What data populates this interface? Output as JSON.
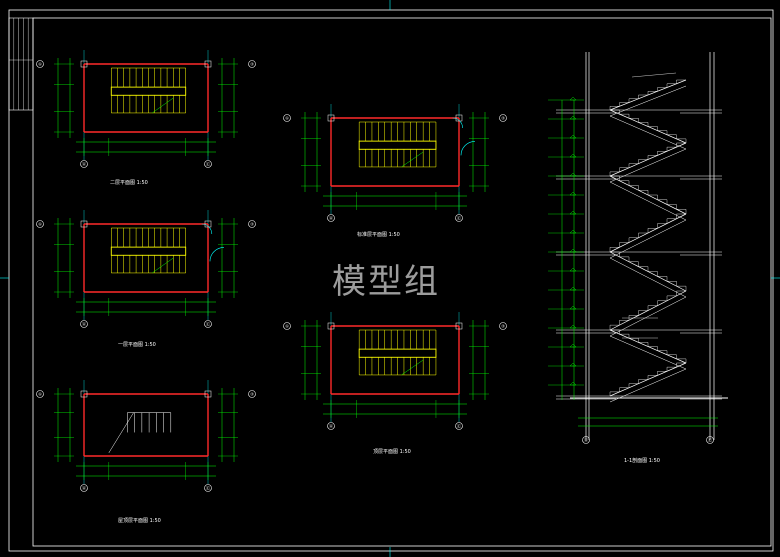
{
  "drawing": {
    "watermark": "模型组",
    "colors": {
      "background": "#000000",
      "frame": "#ffffff",
      "wall": "#ff2a2a",
      "dimension": "#00ff00",
      "stair": "#ffff00",
      "axis": "#00ffff",
      "text": "#ffffff"
    },
    "views": [
      {
        "id": "plan-2f",
        "caption": "二层平面图 1:50",
        "axis_left": "①",
        "axis_right": "③",
        "axis_bottom_left": "Ⓐ",
        "axis_bottom_right": "Ⓒ"
      },
      {
        "id": "plan-1f",
        "caption": "一层平面图 1:50",
        "axis_left": "①",
        "axis_right": "③",
        "axis_bottom_left": "Ⓐ",
        "axis_bottom_right": "Ⓒ"
      },
      {
        "id": "plan-roof",
        "caption": "屋顶层平面图 1:50",
        "axis_left": "①",
        "axis_right": "③",
        "axis_bottom_left": "Ⓐ",
        "axis_bottom_right": "Ⓒ"
      },
      {
        "id": "plan-std",
        "caption": "标准层平面图 1:50",
        "axis_left": "①",
        "axis_right": "③",
        "axis_bottom_left": "Ⓐ",
        "axis_bottom_right": "Ⓒ"
      },
      {
        "id": "plan-top",
        "caption": "顶层平面图 1:50",
        "axis_left": "①",
        "axis_right": "③",
        "axis_bottom_left": "Ⓐ",
        "axis_bottom_right": "Ⓒ"
      },
      {
        "id": "section-1-1",
        "caption": "1-1剖面图 1:50",
        "axis_left": "Ⓐ",
        "axis_right": "Ⓒ",
        "axis_bottom_left": "Ⓐ",
        "axis_bottom_right": "Ⓒ"
      }
    ]
  }
}
